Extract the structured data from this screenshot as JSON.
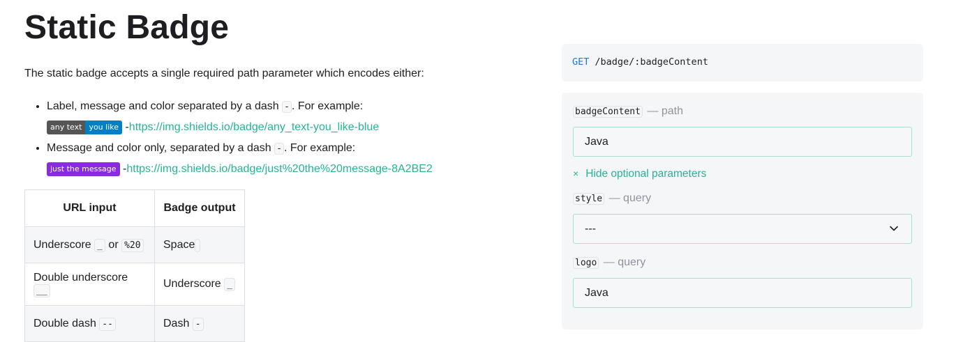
{
  "page": {
    "title": "Static Badge",
    "intro": "The static badge accepts a single required path parameter which encodes either:",
    "bullets": [
      {
        "text_before": "Label, message and color separated by a dash ",
        "code": "-",
        "text_after": ". For example:",
        "badge_label": "any text",
        "badge_message": "you like",
        "dash": "-",
        "link": "https://img.shields.io/badge/any_text-you_like-blue"
      },
      {
        "text_before": "Message and color only, separated by a dash ",
        "code": "-",
        "text_after": ". For example:",
        "badge_message": "just the message",
        "dash": "-",
        "link": "https://img.shields.io/badge/just%20the%20message-8A2BE2"
      }
    ],
    "table": {
      "headers": [
        "URL input",
        "Badge output"
      ],
      "rows": [
        {
          "input_text": "Underscore ",
          "input_code": "_",
          "input_mid": " or ",
          "input_code2": "%20",
          "output_text": "Space ",
          "output_code": " "
        },
        {
          "input_text": "Double underscore ",
          "input_code": "__",
          "output_text": "Underscore ",
          "output_code": "_"
        },
        {
          "input_text": "Double dash ",
          "input_code": "--",
          "output_text": "Dash ",
          "output_code": "-"
        }
      ]
    }
  },
  "endpoint": {
    "method": "GET",
    "path": "/badge/:badgeContent"
  },
  "params": {
    "badgeContent": {
      "name": "badgeContent",
      "kind": "— path",
      "value": "Java"
    },
    "toggle_icon": "×",
    "toggle_label": "Hide optional parameters",
    "style": {
      "name": "style",
      "kind": "— query",
      "value": "---"
    },
    "logo": {
      "name": "logo",
      "kind": "— query",
      "value": "Java"
    }
  },
  "colors": {
    "link": "#25b395",
    "method": "#1877f2",
    "badge_blue": "#007ec6",
    "badge_purple": "#8a2be2"
  }
}
